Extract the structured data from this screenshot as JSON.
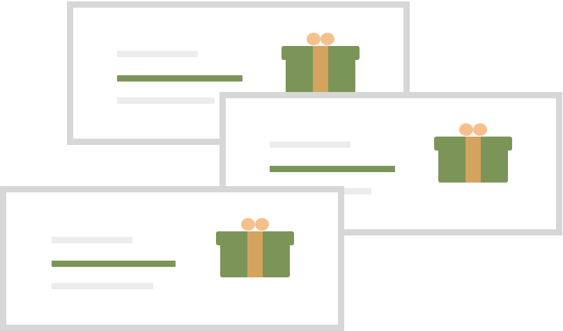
{
  "colors": {
    "card_border": "#d7d7d7",
    "card_background": "#ffffff",
    "line_light": "#ececec",
    "line_accent": "#7b9559",
    "gift_box": "#7b9559",
    "gift_lid": "#7b9559",
    "gift_ribbon": "#d4a35e",
    "gift_bow": "#f6c08d"
  },
  "cards": [
    {
      "icon": "gift-icon"
    },
    {
      "icon": "gift-icon"
    },
    {
      "icon": "gift-icon"
    }
  ]
}
